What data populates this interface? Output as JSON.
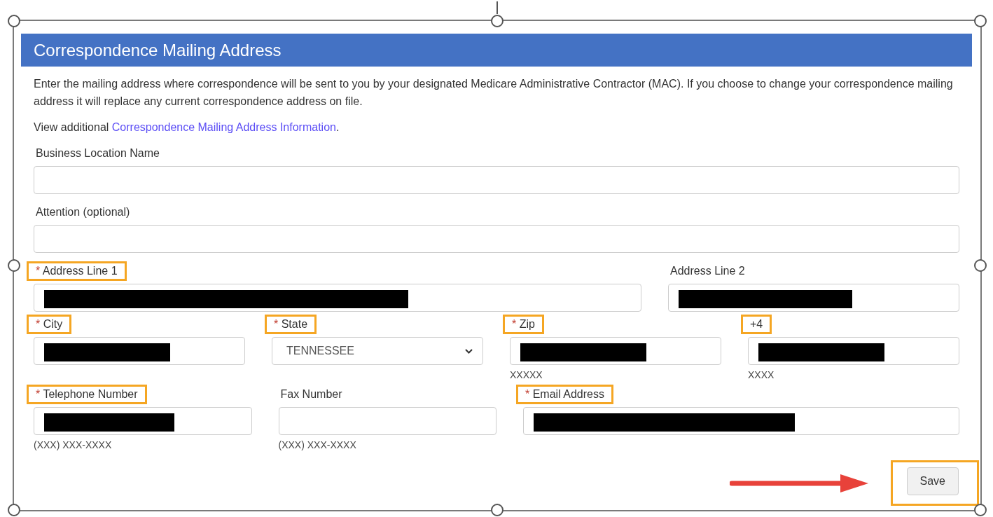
{
  "section": {
    "title": "Correspondence Mailing Address",
    "intro": "Enter the mailing address where correspondence will be sent to you by your designated Medicare Administrative Contractor (MAC). If you choose to change your correspondence mailing address it will replace any current correspondence address on file.",
    "more_prefix": "View additional ",
    "more_link": "Correspondence Mailing Address Information",
    "more_suffix": "."
  },
  "rows": [
    {
      "fields": [
        {
          "label": "Business Location Name",
          "kind": "text",
          "highlighted": false,
          "redacted": false
        }
      ]
    },
    {
      "fields": [
        {
          "label": "Attention (optional)",
          "kind": "text",
          "highlighted": false,
          "redacted": false
        }
      ]
    },
    {
      "fields": [
        {
          "label": "Address Line 1",
          "required_mark": "*",
          "kind": "text",
          "highlighted": true,
          "redacted": true
        },
        {
          "label": "Address Line 2",
          "kind": "text",
          "highlighted": false,
          "redacted": true
        }
      ]
    },
    {
      "fields": [
        {
          "label": "City",
          "required_mark": "*",
          "kind": "text",
          "highlighted": true,
          "redacted": true
        },
        {
          "label": "State",
          "required_mark": "*",
          "kind": "select",
          "value": "TENNESSEE",
          "highlighted": true
        },
        {
          "label": "Zip",
          "required_mark": "*",
          "kind": "text",
          "highlighted": true,
          "redacted": true,
          "hint": "XXXXX"
        },
        {
          "label": "+4",
          "kind": "text",
          "highlighted": true,
          "redacted": true,
          "hint": "XXXX"
        }
      ]
    },
    {
      "fields": [
        {
          "label": "Telephone Number",
          "required_mark": "*",
          "kind": "text",
          "highlighted": true,
          "redacted": true,
          "hint": "(XXX) XXX-XXXX"
        },
        {
          "label": "Fax Number",
          "kind": "text",
          "highlighted": false,
          "redacted": false,
          "hint": "(XXX) XXX-XXXX"
        },
        {
          "label": "Email Address",
          "required_mark": "*",
          "kind": "text",
          "highlighted": true,
          "redacted": true
        }
      ]
    }
  ],
  "save_button": {
    "label": "Save",
    "highlighted": true
  }
}
